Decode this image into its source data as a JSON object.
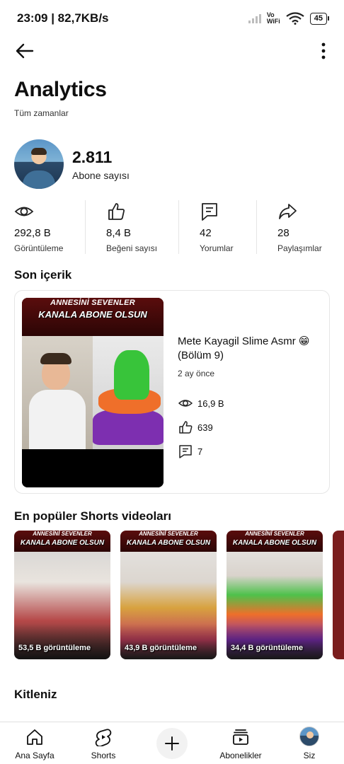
{
  "status_bar": {
    "time_speed": "23:09 | 82,7KB/s",
    "network_label_line1": "Vo",
    "network_label_line2": "WiFi",
    "battery": "45"
  },
  "header": {
    "title": "Analytics",
    "subtitle": "Tüm zamanlar"
  },
  "channel": {
    "subscriber_count": "2.811",
    "subscriber_label": "Abone sayısı"
  },
  "stats": [
    {
      "icon": "eye-icon",
      "value": "292,8 B",
      "label": "Görüntüleme"
    },
    {
      "icon": "thumbs-up-icon",
      "value": "8,4 B",
      "label": "Beğeni sayısı"
    },
    {
      "icon": "comment-icon",
      "value": "42",
      "label": "Yorumlar"
    },
    {
      "icon": "share-icon",
      "value": "28",
      "label": "Paylaşımlar"
    }
  ],
  "recent_content": {
    "section_title": "Son içerik",
    "thumbnail_banner_line1": "ANNESİNİ SEVENLER",
    "thumbnail_banner_line2": "KANALA ABONE OLSUN",
    "video_title": "Mete Kayagil Slime Asmr 😁 (Bölüm 9)",
    "age": "2 ay önce",
    "views": "16,9 B",
    "likes": "639",
    "comments": "7"
  },
  "popular_shorts": {
    "section_title": "En popüler Shorts videoları",
    "banner_line1": "ANNESİNİ SEVENLER",
    "banner_line2": "KANALA ABONE OLSUN",
    "items": [
      {
        "views": "53,5 B görüntüleme"
      },
      {
        "views": "43,9 B görüntüleme"
      },
      {
        "views": "34,4 B görüntüleme"
      }
    ]
  },
  "audience": {
    "section_title": "Kitleniz"
  },
  "bottom_nav": {
    "home": "Ana Sayfa",
    "shorts": "Shorts",
    "subscriptions": "Abonelikler",
    "you": "Siz"
  }
}
